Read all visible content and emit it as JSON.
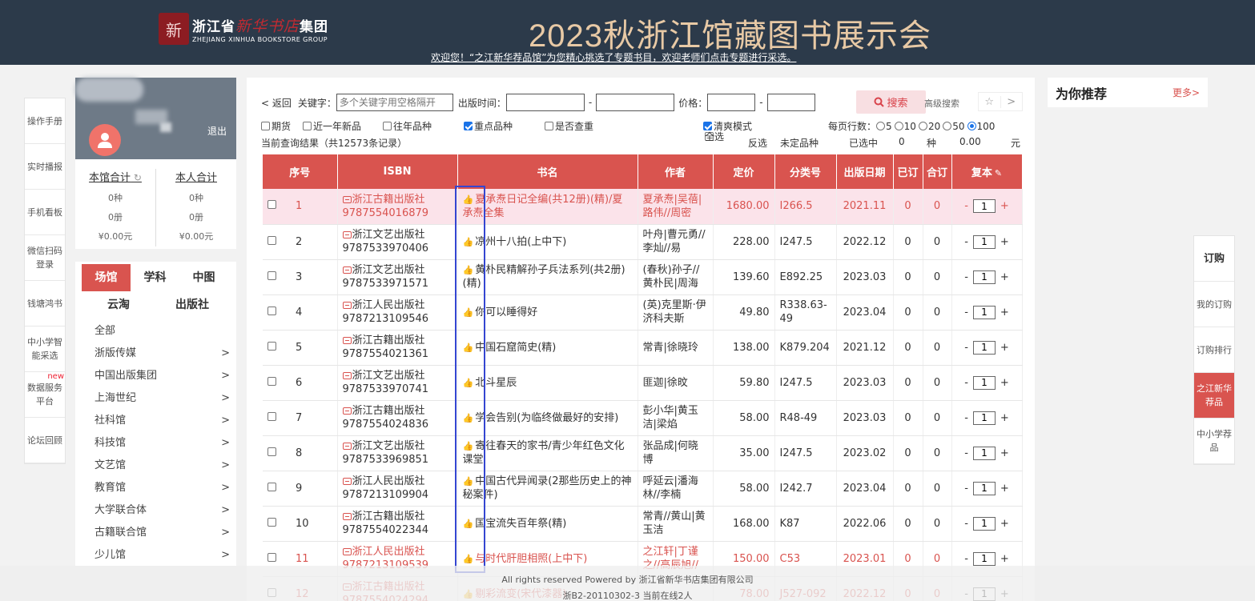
{
  "header": {
    "logo_seal": "新",
    "logo_cn_a": "浙江省",
    "logo_cn_b": "新华书店",
    "logo_cn_c": "集团",
    "logo_en": "ZHEJIANG XINHUA BOOKSTORE GROUP",
    "title": "2023秋浙江馆藏图书展示会",
    "marquee": "欢迎您！“之江新华荐品馆”为您精心挑选了专题书目，欢迎老师们点击专题进行采选。"
  },
  "left_nav": [
    {
      "label": "操作手册"
    },
    {
      "label": "实时播报"
    },
    {
      "label": "手机看板"
    },
    {
      "label": "微信扫码登录"
    },
    {
      "label": "钱塘鸿书"
    },
    {
      "label": "中小学智能采选"
    },
    {
      "label": "数据服务平台",
      "badge": "new"
    },
    {
      "label": "论坛回顾"
    }
  ],
  "profile": {
    "logout": "退出",
    "lib_total": {
      "title": "本馆合计",
      "kinds": "0种",
      "copies": "0册",
      "amount": "¥0.00元"
    },
    "my_total": {
      "title": "本人合计",
      "kinds": "0种",
      "copies": "0册",
      "amount": "¥0.00元"
    }
  },
  "category": {
    "tabs": [
      "场馆",
      "学科",
      "中图",
      "云淘",
      "出版社"
    ],
    "items": [
      {
        "label": "全部",
        "arrow": ""
      },
      {
        "label": "浙版传媒",
        "arrow": ">"
      },
      {
        "label": "中国出版集团",
        "arrow": ">"
      },
      {
        "label": "上海世纪",
        "arrow": ">"
      },
      {
        "label": "社科馆",
        "arrow": ">"
      },
      {
        "label": "科技馆",
        "arrow": ">"
      },
      {
        "label": "文艺馆",
        "arrow": ">"
      },
      {
        "label": "教育馆",
        "arrow": ">"
      },
      {
        "label": "大学联合体",
        "arrow": ">"
      },
      {
        "label": "古籍联合馆",
        "arrow": ">"
      },
      {
        "label": "少儿馆",
        "arrow": ">"
      }
    ]
  },
  "search": {
    "back": "< 返回",
    "keyword_label": "关键字：",
    "keyword_placeholder": "多个关键字用空格隔开",
    "date_label": "出版时间：",
    "dash": "-",
    "price_label": "价格：",
    "search_btn": "搜索",
    "advanced": "高级搜索",
    "star": "☆",
    "next": ">"
  },
  "options": {
    "futures": "期货",
    "recent": "近一年新品",
    "past": "往年品种",
    "key": "重点品种",
    "dup": "是否查重",
    "clear_mode": "清爽模式",
    "per_page_label": "每页行数：",
    "per_page": [
      "5",
      "10",
      "20",
      "50",
      "100"
    ],
    "result": "当前查询结果（共12573条记录）",
    "select_all": "全选",
    "invert": "反选",
    "undecided": "未定品种",
    "selected_label": "已选中",
    "selected_count": "0",
    "kind_unit": "种",
    "selected_amount": "0.00",
    "yuan": "元"
  },
  "table": {
    "headers": [
      "序号",
      "ISBN",
      "书名",
      "作者",
      "定价",
      "分类号",
      "出版日期",
      "已订",
      "合订",
      "复本"
    ],
    "rows": [
      {
        "no": "1",
        "pub": "浙江古籍出版社",
        "isbn": "9787554016879",
        "title": "夏承焘日记全编(共12册)(精)/夏承焘全集",
        "author": "夏承焘|吴蓓|路伟//周密",
        "price": "1680.00",
        "cls": "I266.5",
        "date": "2021.11",
        "ordered": "0",
        "total": "0",
        "qty": "1"
      },
      {
        "no": "2",
        "pub": "浙江文艺出版社",
        "isbn": "9787533970406",
        "title": "凉州十八拍(上中下)",
        "author": "叶舟|曹元勇//李灿//易",
        "price": "228.00",
        "cls": "I247.5",
        "date": "2022.12",
        "ordered": "0",
        "total": "0",
        "qty": "1"
      },
      {
        "no": "3",
        "pub": "浙江文艺出版社",
        "isbn": "9787533971571",
        "title": "黄朴民精解孙子兵法系列(共2册)(精)",
        "author": "(春秋)孙子//黄朴民|周海",
        "price": "139.60",
        "cls": "E892.25",
        "date": "2023.03",
        "ordered": "0",
        "total": "0",
        "qty": "1"
      },
      {
        "no": "4",
        "pub": "浙江人民出版社",
        "isbn": "9787213109546",
        "title": "你可以睡得好",
        "author": "(英)克里斯·伊济科夫斯",
        "price": "49.80",
        "cls": "R338.63-49",
        "date": "2023.04",
        "ordered": "0",
        "total": "0",
        "qty": "1"
      },
      {
        "no": "5",
        "pub": "浙江古籍出版社",
        "isbn": "9787554021361",
        "title": "中国石窟简史(精)",
        "author": "常青|徐晓玲",
        "price": "138.00",
        "cls": "K879.204",
        "date": "2021.12",
        "ordered": "0",
        "total": "0",
        "qty": "1"
      },
      {
        "no": "6",
        "pub": "浙江文艺出版社",
        "isbn": "9787533970741",
        "title": "北斗星辰",
        "author": "匪迦|徐旼",
        "price": "59.80",
        "cls": "I247.5",
        "date": "2023.03",
        "ordered": "0",
        "total": "0",
        "qty": "1"
      },
      {
        "no": "7",
        "pub": "浙江古籍出版社",
        "isbn": "9787554024836",
        "title": "学会告别(为临终做最好的安排)",
        "author": "彭小华|黄玉洁|梁焰",
        "price": "58.00",
        "cls": "R48-49",
        "date": "2023.03",
        "ordered": "0",
        "total": "0",
        "qty": "1"
      },
      {
        "no": "8",
        "pub": "浙江文艺出版社",
        "isbn": "9787533969851",
        "title": "寄往春天的家书/青少年红色文化课堂",
        "author": "张品成|何晓博",
        "price": "35.00",
        "cls": "I247.5",
        "date": "2023.02",
        "ordered": "0",
        "total": "0",
        "qty": "1"
      },
      {
        "no": "9",
        "pub": "浙江人民出版社",
        "isbn": "9787213109904",
        "title": "中国古代异闻录(2那些历史上的神秘案件)",
        "author": "呼延云|潘海林//李楠",
        "price": "58.00",
        "cls": "I242.7",
        "date": "2023.04",
        "ordered": "0",
        "total": "0",
        "qty": "1"
      },
      {
        "no": "10",
        "pub": "浙江古籍出版社",
        "isbn": "9787554022344",
        "title": "国宝流失百年祭(精)",
        "author": "常青//黄山|黄玉洁",
        "price": "168.00",
        "cls": "K87",
        "date": "2022.06",
        "ordered": "0",
        "total": "0",
        "qty": "1"
      },
      {
        "no": "11",
        "pub": "浙江人民出版社",
        "isbn": "9787213109539",
        "title": "与时代肝胆相照(上中下)",
        "author": "之江轩|丁谨之//高辰旭//",
        "price": "150.00",
        "cls": "C53",
        "date": "2023.01",
        "ordered": "0",
        "total": "0",
        "qty": "1"
      },
      {
        "no": "12",
        "pub": "浙江古籍出版社",
        "isbn": "9787554024294",
        "title": "剔彩流变(宋代漆器)",
        "author": "",
        "price": "78.00",
        "cls": "J527-092",
        "date": "2022.12",
        "ordered": "0",
        "total": "0",
        "qty": "1"
      }
    ]
  },
  "footer": {
    "line1": "All rights reserved Powered by 浙江省新华书店集团有限公司",
    "line2": "浙B2-20110302-3   当前在线2人"
  },
  "recommend": {
    "title": "为你推荐",
    "more": "更多>"
  },
  "right_nav": [
    {
      "label": "订购"
    },
    {
      "label": "我的订购"
    },
    {
      "label": "订购排行"
    },
    {
      "label": "之江新华荐品"
    },
    {
      "label": "中小学荐品"
    }
  ],
  "colors": {
    "header_bg": "#2c3a4a",
    "accent": "#d9544f",
    "title_gold": "#e8c9a5",
    "highlight_row": "#fbe3ea",
    "annotation_box": "#3446d1"
  }
}
